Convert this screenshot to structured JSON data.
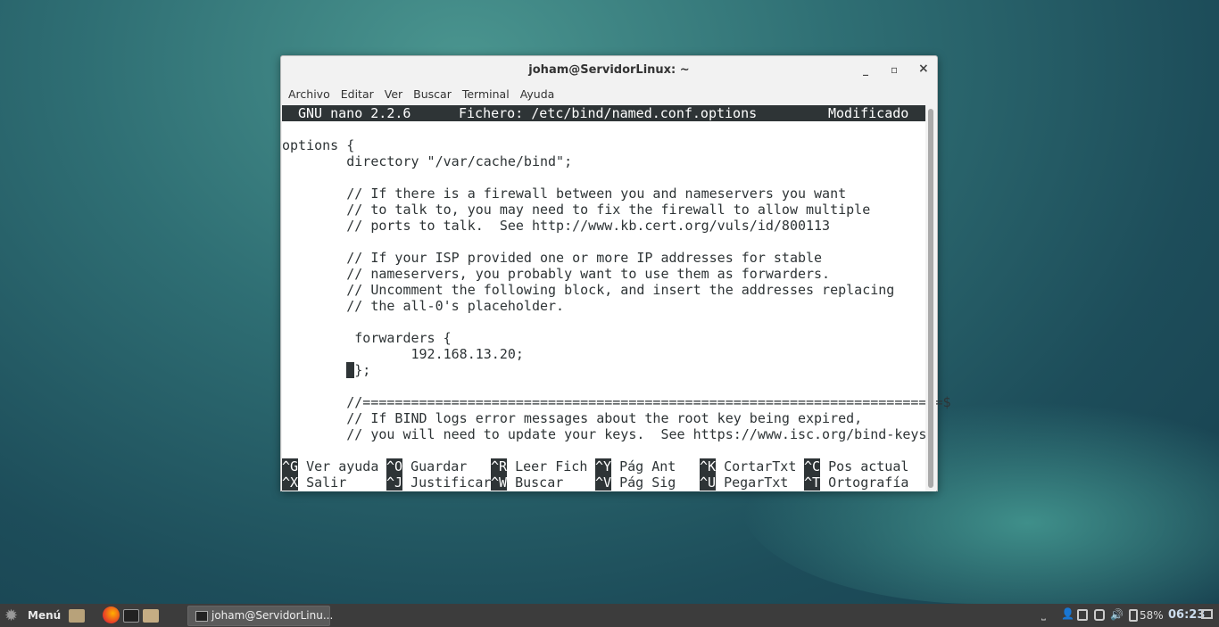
{
  "window": {
    "title": "joham@ServidorLinux: ~",
    "controls": {
      "minimize": "_",
      "maximize": "▫",
      "close": "×"
    }
  },
  "menu": [
    "Archivo",
    "Editar",
    "Ver",
    "Buscar",
    "Terminal",
    "Ayuda"
  ],
  "nano": {
    "version": "GNU nano 2.2.6",
    "file": "Fichero: /etc/bind/named.conf.options",
    "status": "Modificado",
    "lines": [
      "",
      "options {",
      "        directory \"/var/cache/bind\";",
      "",
      "        // If there is a firewall between you and nameservers you want",
      "        // to talk to, you may need to fix the firewall to allow multiple",
      "        // ports to talk.  See http://www.kb.cert.org/vuls/id/800113",
      "",
      "        // If your ISP provided one or more IP addresses for stable",
      "        // nameservers, you probably want to use them as forwarders.",
      "        // Uncomment the following block, and insert the addresses replacing",
      "        // the all-0's placeholder.",
      "",
      " \t forwarders {",
      "                192.168.13.20;"
    ],
    "cursor_line_before": "        ",
    "cursor_line_after": "};",
    "lines_after": [
      "",
      "        //========================================================================$",
      "        // If BIND logs error messages about the root key being expired,",
      "        // you will need to update your keys.  See https://www.isc.org/bind-keys",
      ""
    ],
    "shortcuts": [
      [
        {
          "key": "^G",
          "label": "Ver ayuda"
        },
        {
          "key": "^O",
          "label": "Guardar"
        },
        {
          "key": "^R",
          "label": "Leer Fich"
        },
        {
          "key": "^Y",
          "label": "Pág Ant"
        },
        {
          "key": "^K",
          "label": "CortarTxt"
        },
        {
          "key": "^C",
          "label": "Pos actual"
        }
      ],
      [
        {
          "key": "^X",
          "label": "Salir"
        },
        {
          "key": "^J",
          "label": "Justificar"
        },
        {
          "key": "^W",
          "label": "Buscar"
        },
        {
          "key": "^V",
          "label": "Pág Sig"
        },
        {
          "key": "^U",
          "label": "PegarTxt"
        },
        {
          "key": "^T",
          "label": "Ortografía"
        }
      ]
    ]
  },
  "taskbar": {
    "menu_label": "Menú",
    "task_label": "joham@ServidorLinu...",
    "battery": "58%",
    "clock": "06:23"
  }
}
